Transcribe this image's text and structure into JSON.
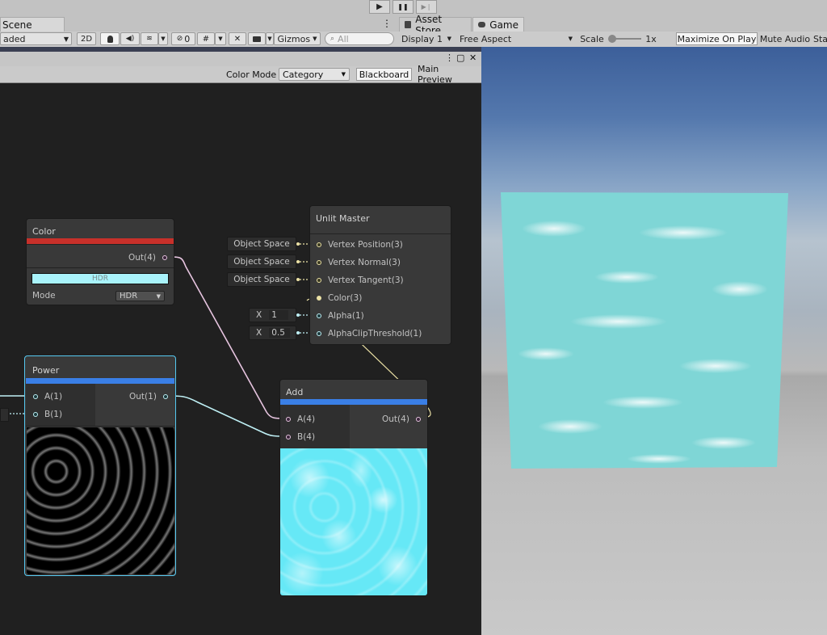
{
  "playbar": {
    "play": "▶",
    "pause": "❚❚",
    "step": "▶❘"
  },
  "tabs": {
    "scene": "Scene",
    "asset_store": "Asset Store",
    "game": "Game",
    "more": "⋮"
  },
  "scene_toolbar": {
    "shading": "aded",
    "mode_2d": "2D",
    "hidden_count": "0",
    "gizmos": "Gizmos",
    "search_placeholder": "All"
  },
  "game_toolbar": {
    "display": "Display 1",
    "aspect": "Free Aspect",
    "scale_label": "Scale",
    "scale_value": "1x",
    "maximize": "Maximize On Play",
    "mute": "Mute Audio",
    "stats": "Sta"
  },
  "shader_graph": {
    "window_controls": {
      "menu": "⋮",
      "maximize": "▢",
      "close": "✕"
    },
    "color_mode_label": "Color Mode",
    "color_mode_value": "Category",
    "blackboard": "Blackboard",
    "main_preview": "Main Preview"
  },
  "nodes": {
    "color": {
      "title": "Color",
      "title_color": "#c8302a",
      "out": "Out(4)",
      "swatch_label": "HDR",
      "swatch_color": "#a9f3fb",
      "mode_label": "Mode",
      "mode_value": "HDR"
    },
    "power": {
      "title": "Power",
      "title_color": "#3a7fe6",
      "in_a": "A(1)",
      "in_b": "B(1)",
      "out": "Out(1)"
    },
    "add": {
      "title": "Add",
      "title_color": "#3a7fe6",
      "in_a": "A(4)",
      "in_b": "B(4)",
      "out": "Out(4)"
    },
    "unlit_master": {
      "title": "Unlit Master",
      "ports": [
        "Vertex Position(3)",
        "Vertex Normal(3)",
        "Vertex Tangent(3)",
        "Color(3)",
        "Alpha(1)",
        "AlphaClipThreshold(1)"
      ],
      "space_fields": [
        "Object Space",
        "Object Space",
        "Object Space"
      ],
      "alpha_axis": "X",
      "alpha_value": "1",
      "clip_axis": "X",
      "clip_value": "0.5"
    }
  },
  "colors": {
    "water": "#66e8f6",
    "game_quad": "#7fd6d6"
  }
}
